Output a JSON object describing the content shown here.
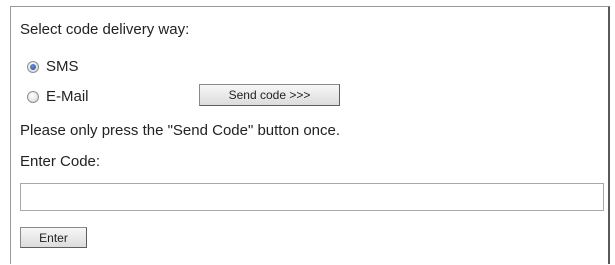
{
  "form": {
    "heading": "Select code delivery way:",
    "delivery_options": [
      {
        "label": "SMS",
        "selected": true
      },
      {
        "label": "E-Mail",
        "selected": false
      }
    ],
    "send_button_label": "Send code >>>",
    "note": "Please only press the \"Send Code\" button once.",
    "code_label": "Enter Code:",
    "code_value": "",
    "enter_button_label": "Enter"
  }
}
